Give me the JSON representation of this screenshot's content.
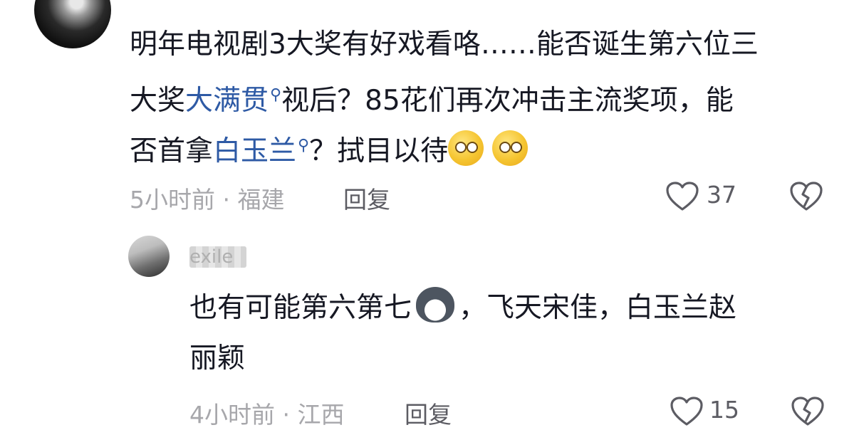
{
  "comment": {
    "line1": "明年电视剧3大奖有好戏看咯……能否诞生第六位三",
    "line2_pre": "大奖",
    "line2_link": "大满贯",
    "line2_post": "视后？85花们再次冲击主流奖项，能",
    "line3_pre": "否首拿",
    "line3_link": "白玉兰",
    "line3_post": "？拭目以待",
    "search_icon": "search-icon",
    "emoji": "dizzy-face-emoji",
    "time_location": "5小时前 · 福建",
    "reply_label": "回复",
    "like_count": "37"
  },
  "reply": {
    "username": "exile",
    "line1_pre": "也有可能第六第七",
    "emoji": "husky-dog-emoji",
    "line1_post": "，飞天宋佳，白玉兰赵",
    "line2": "丽颖",
    "time_location": "4小时前 · 江西",
    "reply_label": "回复",
    "like_count": "15"
  },
  "colors": {
    "text": "#161823",
    "meta": "#a7a7ab",
    "link": "#2e5aa5",
    "action": "#5c5c63"
  }
}
